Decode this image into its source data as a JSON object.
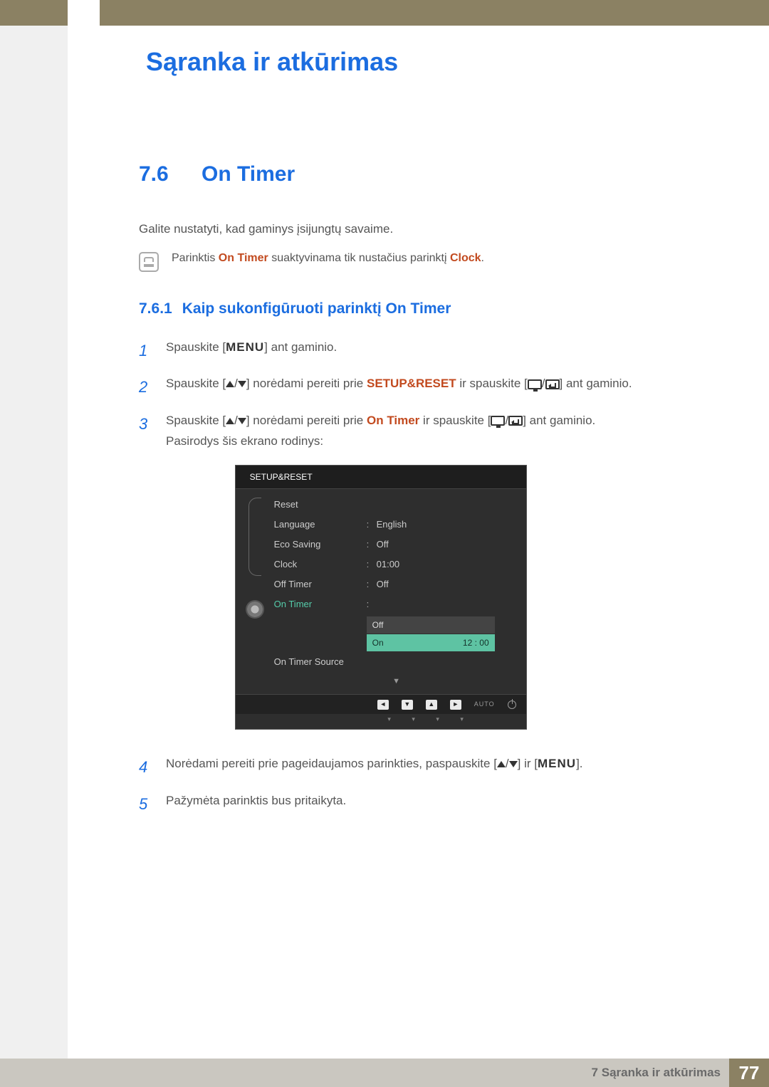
{
  "chapter_title": "Sąranka ir atkūrimas",
  "section": {
    "num": "7.6",
    "title": "On Timer"
  },
  "lead": "Galite nustatyti, kad gaminys įsijungtų savaime.",
  "note": {
    "pre": "Parinktis ",
    "hl1": "On Timer",
    "mid": " suaktyvinama tik nustačius parinktį ",
    "hl2": "Clock",
    "post": "."
  },
  "subsection": {
    "num": "7.6.1",
    "title": "Kaip sukonfigūruoti parinktį On Timer"
  },
  "menu_label": "MENU",
  "steps": {
    "s1": {
      "pre": "Spauskite [",
      "post": "] ant gaminio."
    },
    "s2": {
      "pre": "Spauskite [",
      "mid": "] norėdami pereiti prie ",
      "hl": "SETUP&RESET",
      "post1": " ir spauskite [",
      "post2": "] ant gaminio."
    },
    "s3": {
      "pre": "Spauskite [",
      "mid": "] norėdami pereiti prie ",
      "hl": "On Timer",
      "post1": " ir spauskite [",
      "post2": "] ant gaminio.",
      "line2": "Pasirodys šis ekrano rodinys:"
    },
    "s4": {
      "pre": "Norėdami pereiti prie pageidaujamos parinkties, paspauskite [",
      "mid": "] ir [",
      "post": "]."
    },
    "s5": "Pažymėta parinktis bus pritaikyta."
  },
  "osd": {
    "title": "SETUP&RESET",
    "rows": [
      {
        "label": "Reset",
        "val": ""
      },
      {
        "label": "Language",
        "val": "English"
      },
      {
        "label": "Eco Saving",
        "val": "Off"
      },
      {
        "label": "Clock",
        "val": "01:00"
      },
      {
        "label": "Off Timer",
        "val": "Off"
      },
      {
        "label": "On Timer",
        "val": "",
        "selected": true
      },
      {
        "label": "On Timer Source",
        "val": ""
      }
    ],
    "dropdown": {
      "opt1": "Off",
      "opt2_label": "On",
      "opt2_time": "12 : 00"
    },
    "auto": "AUTO"
  },
  "footer": {
    "chapter": "7 Sąranka ir atkūrimas",
    "page": "77"
  }
}
